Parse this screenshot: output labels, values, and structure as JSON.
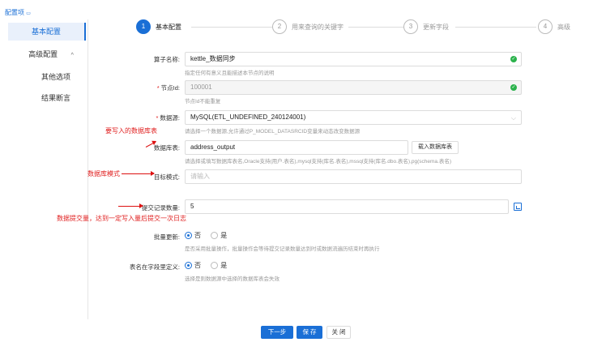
{
  "topnote": "配置项",
  "sidebar": {
    "items": [
      {
        "label": "基本配置"
      },
      {
        "label": "高级配置",
        "chevron": "^"
      },
      {
        "label": "其他选项"
      },
      {
        "label": "结果断言"
      }
    ]
  },
  "steps": [
    {
      "num": "1",
      "label": "基本配置"
    },
    {
      "num": "2",
      "label": "用来查询的关键字"
    },
    {
      "num": "3",
      "label": "更新字段"
    },
    {
      "num": "4",
      "label": "高级"
    }
  ],
  "form": {
    "name": {
      "label": "算子名称:",
      "value": "kettle_数据同步",
      "hint": "指定任何有意义且能描述本节点的说明"
    },
    "node_id": {
      "label": "节点Id:",
      "value": "100001",
      "hint": "节点Id不能重复"
    },
    "datasource": {
      "label": "数据源:",
      "value": "MySQL(ETL_UNDEFINED_240124001)",
      "hint": "请选择一个数据源,允许通过P_MODEL_DATASRCID变量来动态改变数据源"
    },
    "table": {
      "label": "数据库表:",
      "value": "address_output",
      "button": "载入数据库表",
      "hint": "请选择或填写数据库表名,Oracle支持(用户.表名),mysql支持(库名.表名),mssql支持(库名.dbo.表名),pg(schema.表名)"
    },
    "schema": {
      "label": "目标模式:",
      "placeholder": "请输入"
    },
    "commit": {
      "label": "提交记录数量:",
      "value": "5"
    },
    "batch": {
      "label": "批量更新:",
      "opt_no": "否",
      "opt_yes": "是",
      "hint": "是否采用批量操作，批量操作会等待提交记录数量达到时或数据流遍历结束时再执行"
    },
    "tablename_field": {
      "label": "表名在字段里定义:",
      "opt_no": "否",
      "opt_yes": "是",
      "hint": "选择是则数据源中选择的数据库表会失效"
    }
  },
  "annotations": {
    "table": "要写入的数据库表",
    "schema": "数据库模式",
    "commit": "数据提交量，达到一定写入量后提交一次日志"
  },
  "footer": {
    "next": "下一步",
    "save": "保 存",
    "close": "关 闭"
  },
  "colors": {
    "accent": "#1a6fd6",
    "annotation": "#e02020",
    "success": "#2bb24c"
  }
}
